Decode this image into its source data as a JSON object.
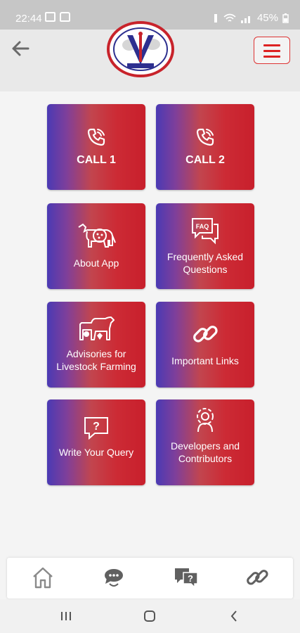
{
  "status_bar": {
    "time": "22:44",
    "battery": "45%"
  },
  "header": {
    "logo_name": "institution-emblem"
  },
  "tiles": [
    {
      "label": "CALL 1",
      "icon": "phone-call-icon"
    },
    {
      "label": "CALL 2",
      "icon": "phone-call-icon"
    },
    {
      "label": "About App",
      "icon": "cow-icon"
    },
    {
      "label": "Frequently Asked Questions",
      "icon": "faq-chat-icon"
    },
    {
      "label": "Advisories for Livestock Farming",
      "icon": "livestock-icon"
    },
    {
      "label": "Important Links",
      "icon": "link-icon"
    },
    {
      "label": "Write Your Query",
      "icon": "question-bubble-icon"
    },
    {
      "label": "Developers and Contributors",
      "icon": "developer-gear-icon"
    }
  ],
  "bottom_nav": [
    "home-icon",
    "support-chat-icon",
    "faq-bubbles-icon",
    "link-icon"
  ],
  "colors": {
    "tile_left": "#4a3ab4",
    "tile_right": "#c81f2c",
    "accent": "#d22222"
  }
}
